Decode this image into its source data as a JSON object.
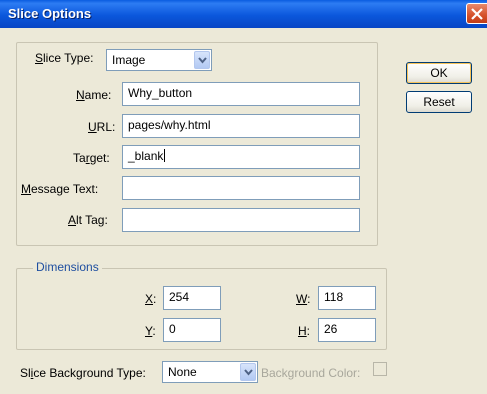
{
  "window": {
    "title": "Slice Options"
  },
  "buttons": {
    "ok": "OK",
    "reset": "Reset"
  },
  "slice": {
    "type_label": "Slice Type:",
    "type_value": "Image",
    "fields": [
      {
        "label": "Name:",
        "value": "Why_button"
      },
      {
        "label": "URL:",
        "value": "pages/why.html"
      },
      {
        "label": "Target:",
        "value": "_blank"
      },
      {
        "label": "Message Text:",
        "value": ""
      },
      {
        "label": "Alt Tag:",
        "value": ""
      }
    ]
  },
  "dimensions": {
    "legend": "Dimensions",
    "x_label": "X:",
    "x_value": "254",
    "y_label": "Y:",
    "y_value": "0",
    "w_label": "W:",
    "w_value": "118",
    "h_label": "H:",
    "h_value": "26"
  },
  "background": {
    "type_label": "Slice Background Type:",
    "type_value": "None",
    "color_label": "Background Color:"
  },
  "colors": {
    "titlebar": "#0b57dc",
    "close": "#d5512b",
    "dialog_bg": "#ece9d8",
    "legend_blue": "#1f4fa0"
  }
}
